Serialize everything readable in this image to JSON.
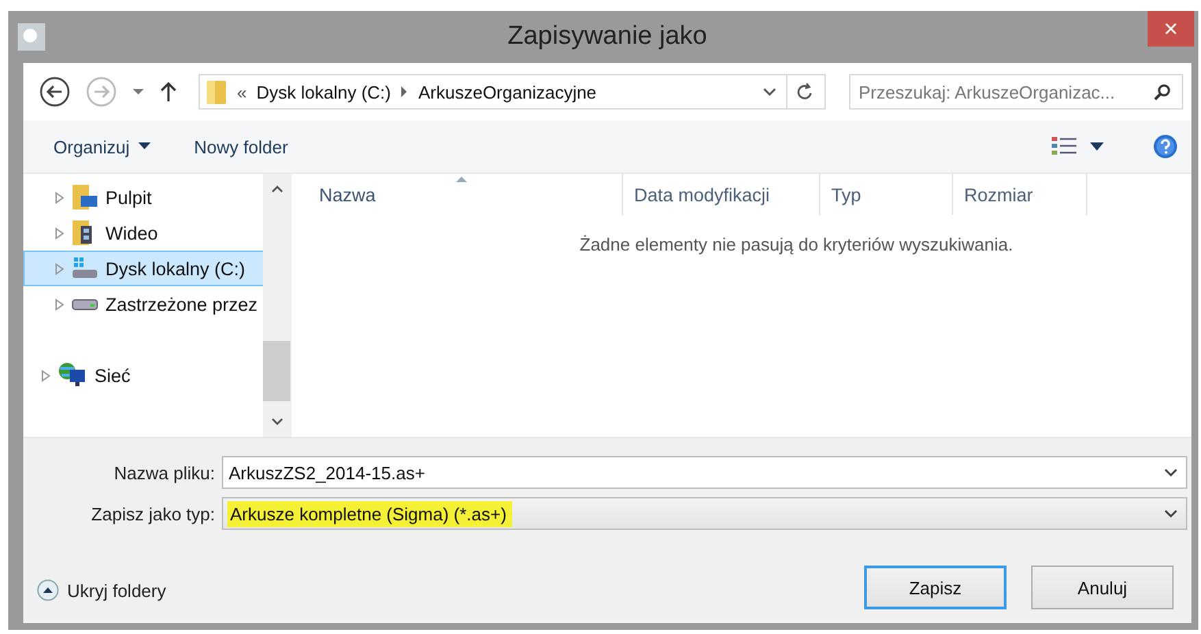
{
  "window": {
    "title": "Zapisywanie jako",
    "close": "×"
  },
  "address": {
    "prefix": "«",
    "path": [
      "Dysk lokalny (C:)",
      "ArkuszeOrganizacyjne"
    ]
  },
  "search": {
    "placeholder": "Przeszukaj: ArkuszeOrganizac..."
  },
  "toolbar": {
    "organize": "Organizuj",
    "new_folder": "Nowy folder"
  },
  "tree": [
    {
      "children": [
        {
          "label": "Pulpit",
          "kind": "desktop",
          "expanded": false,
          "selected": false
        },
        {
          "label": "Wideo",
          "kind": "video",
          "expanded": false,
          "selected": false
        },
        {
          "label": "Dysk lokalny (C:)",
          "kind": "system-drive",
          "expanded": false,
          "selected": true
        },
        {
          "label": "Zastrzeżone przez",
          "kind": "drive",
          "expanded": false,
          "selected": false
        }
      ]
    },
    {
      "label": "Sieć",
      "kind": "network",
      "expanded": false,
      "selected": false
    }
  ],
  "columns": [
    {
      "label": "Nazwa",
      "sorted": true
    },
    {
      "label": "Data modyfikacji",
      "sorted": false
    },
    {
      "label": "Typ",
      "sorted": false
    },
    {
      "label": "Rozmiar",
      "sorted": false
    }
  ],
  "empty_message": "Żadne elementy nie pasują do kryteriów wyszukiwania.",
  "filename": {
    "label": "Nazwa pliku:",
    "value": "ArkuszZS2_2014-15.as+"
  },
  "filetype": {
    "label": "Zapisz jako typ:",
    "value": "Arkusze kompletne (Sigma) (*.as+)",
    "highlighted": true
  },
  "hide_folders": "Ukryj foldery",
  "buttons": [
    {
      "label": "Zapisz",
      "default": true
    },
    {
      "label": "Anuluj",
      "default": false
    }
  ]
}
